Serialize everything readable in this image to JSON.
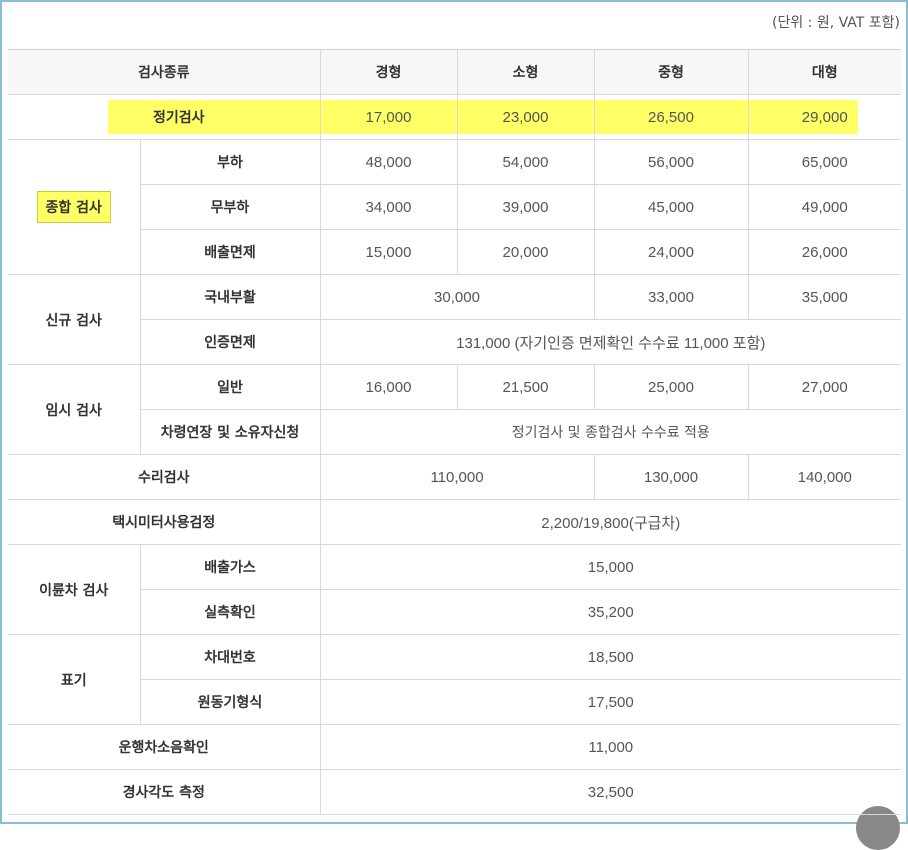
{
  "unit_note": "(단위 : 원, VAT 포함)",
  "header": {
    "type_label": "검사종류",
    "cols": [
      "경형",
      "소형",
      "중형",
      "대형"
    ]
  },
  "regular": {
    "label": "정기검사",
    "values": [
      "17,000",
      "23,000",
      "26,500",
      "29,000"
    ]
  },
  "comprehensive": {
    "label": "종합 검사",
    "rows": [
      {
        "sub": "부하",
        "values": [
          "48,000",
          "54,000",
          "56,000",
          "65,000"
        ]
      },
      {
        "sub": "무부하",
        "values": [
          "34,000",
          "39,000",
          "45,000",
          "49,000"
        ]
      },
      {
        "sub": "배출면제",
        "values": [
          "15,000",
          "20,000",
          "24,000",
          "26,000"
        ]
      }
    ]
  },
  "new": {
    "label": "신규 검사",
    "domestic": {
      "sub": "국내부활",
      "small": "30,000",
      "mid": "33,000",
      "large": "35,000"
    },
    "cert": {
      "sub": "인증면제",
      "text": "131,000 (자기인증 면제확인 수수료 11,000 포함)"
    }
  },
  "temp": {
    "label": "임시 검사",
    "general": {
      "sub": "일반",
      "values": [
        "16,000",
        "21,500",
        "25,000",
        "27,000"
      ]
    },
    "extend": {
      "sub": "차령연장 및 소유자신청",
      "text": "정기검사 및 종합검사 수수료 적용"
    }
  },
  "repair": {
    "label": "수리검사",
    "small": "110,000",
    "mid": "130,000",
    "large": "140,000"
  },
  "taxi": {
    "label": "택시미터사용검정",
    "text": "2,200/19,800(구급차)"
  },
  "twowheel": {
    "label": "이륜차 검사",
    "rows": [
      {
        "sub": "배출가스",
        "value": "15,000"
      },
      {
        "sub": "실측확인",
        "value": "35,200"
      }
    ]
  },
  "marking": {
    "label": "표기",
    "rows": [
      {
        "sub": "차대번호",
        "value": "18,500"
      },
      {
        "sub": "원동기형식",
        "value": "17,500"
      }
    ]
  },
  "noise": {
    "label": "운행차소음확인",
    "value": "11,000"
  },
  "tilt": {
    "label": "경사각도 측정",
    "value": "32,500"
  },
  "colors": {
    "highlight": "#ffff66",
    "frame": "#8bbdd3",
    "header_bg": "#f7f7f7"
  }
}
